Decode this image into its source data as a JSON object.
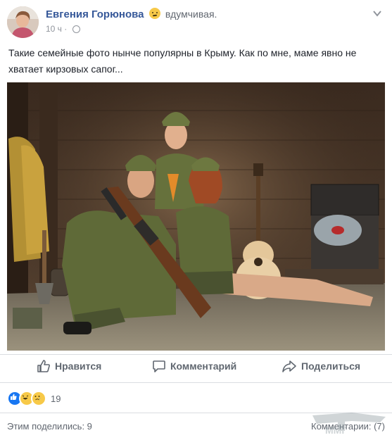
{
  "post": {
    "author": "Евгения Горюнова",
    "feeling": "вдумчивая.",
    "time": "10 ч",
    "time_separator": "·",
    "text": "Такие семейные фото нынче популярны в Крыму. Как по мне, маме явно не хватает кирзовых сапог..."
  },
  "actions": {
    "like": "Нравится",
    "comment": "Комментарий",
    "share": "Поделиться"
  },
  "reactions": {
    "count": "19",
    "types": [
      "like-icon",
      "haha-icon",
      "sad-icon"
    ]
  },
  "footer": {
    "shares": "Этим поделились: 9",
    "comments": "Комментарии: (7)"
  },
  "watermark": {
    "text": "ММГ"
  },
  "colors": {
    "author": "#365899",
    "muted": "#90949c",
    "action": "#606770",
    "like_blue": "#1877f2"
  }
}
